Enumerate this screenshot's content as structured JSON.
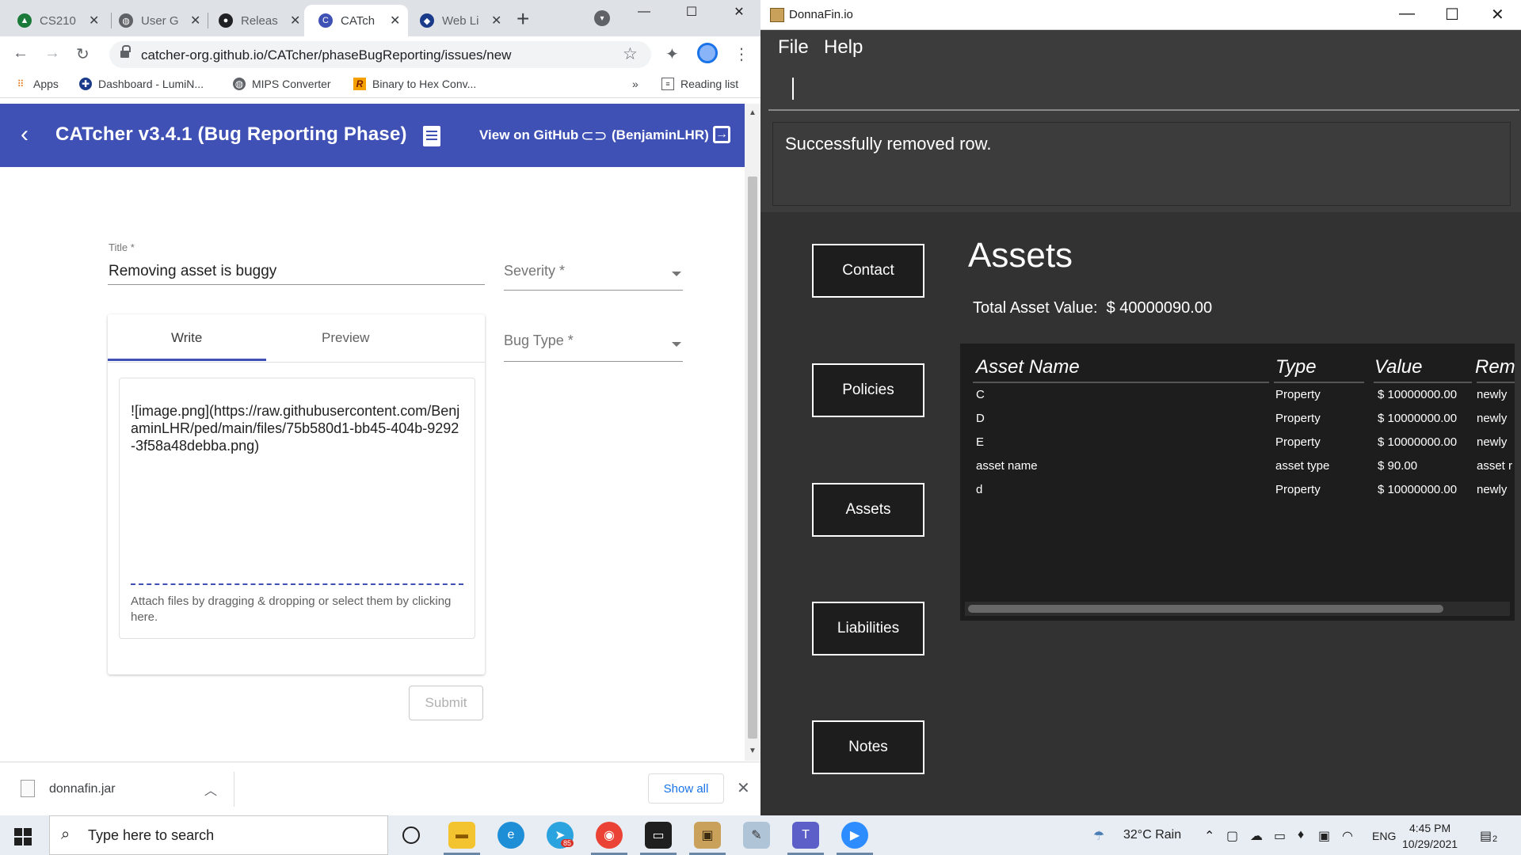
{
  "browser": {
    "tabs": [
      {
        "label": "CS210",
        "color": "#1b7a3a",
        "icon": "graduation-cap-icon"
      },
      {
        "label": "User G",
        "color": "#5f6368",
        "icon": "globe-icon"
      },
      {
        "label": "Releas",
        "color": "#202124",
        "icon": "github-icon"
      },
      {
        "label": "CATch",
        "color": "#3f51b5",
        "icon": "catcher-icon"
      },
      {
        "label": "Web Li",
        "color": "#1a3a8a",
        "icon": "web-icon"
      }
    ],
    "active_tab": 3,
    "url": "catcher-org.github.io/CATcher/phaseBugReporting/issues/new",
    "bookmarks": {
      "apps": "Apps",
      "b1": "Dashboard - LumiN...",
      "b2": "MIPS Converter",
      "b3": "Binary to Hex Conv...",
      "more": "»",
      "reading": "Reading list"
    }
  },
  "catcher": {
    "app_title": "CATcher v3.4.1  (Bug Reporting Phase)",
    "github_link": "View on GitHub",
    "user": "(BenjaminLHR)",
    "title_label": "Title *",
    "title_value": "Removing asset is buggy",
    "severity_label": "Severity *",
    "bug_type_label": "Bug Type *",
    "tab_write": "Write",
    "tab_preview": "Preview",
    "body": "![image.png](https://raw.githubusercontent.com/BenjaminLHR/ped/main/files/75b580d1-bb45-404b-9292-3f58a48debba.png)",
    "attach_hint": "Attach files by dragging & dropping or select them by clicking here.",
    "submit": "Submit"
  },
  "downloads": {
    "file": "donnafin.jar",
    "show_all": "Show all"
  },
  "donnafin": {
    "window_title": "DonnaFin.io",
    "menu": [
      "File",
      "Help"
    ],
    "command": "",
    "result": "Successfully removed row.",
    "nav": [
      "Contact",
      "Policies",
      "Assets",
      "Liabilities",
      "Notes"
    ],
    "section_title": "Assets",
    "total_label": "Total Asset Value:  $ 40000090.00",
    "columns": [
      "Asset Name",
      "Type",
      "Value",
      "Rem"
    ],
    "rows": [
      [
        "C",
        "Property",
        "$ 10000000.00",
        "newly"
      ],
      [
        "D",
        "Property",
        "$ 10000000.00",
        "newly"
      ],
      [
        "E",
        "Property",
        "$ 10000000.00",
        "newly"
      ],
      [
        "asset name",
        "asset type",
        "$ 90.00",
        "asset r"
      ],
      [
        "d",
        "Property",
        "$ 10000000.00",
        "newly"
      ]
    ]
  },
  "taskbar": {
    "search_placeholder": "Type here to search",
    "weather": "32°C  Rain",
    "lang": "ENG",
    "time": "4:45 PM",
    "date": "10/29/2021",
    "notif_count": "2",
    "telegram_badge": "85"
  }
}
